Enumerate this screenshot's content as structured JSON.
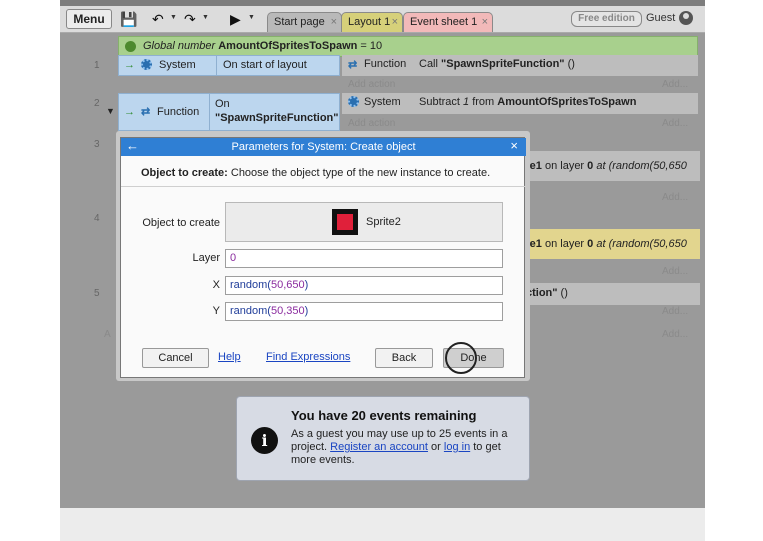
{
  "toolbar": {
    "menu_label": "Menu",
    "tabs": [
      {
        "label": "Start page"
      },
      {
        "label": "Layout 1"
      },
      {
        "label": "Event sheet 1"
      }
    ],
    "edition_badge": "Free edition",
    "user_label": "Guest"
  },
  "sheet": {
    "global_var": {
      "prefix": "Global number",
      "name": "AmountOfSpritesToSpawn",
      "value_text": "= 10"
    },
    "rows": [
      {
        "number": "1",
        "cond_object": "System",
        "cond_text": "On start of layout",
        "act_object": "Function",
        "act_text_prefix": "Call ",
        "act_text_bold": "\"SpawnSpriteFunction\"",
        "act_text_suffix": " ()",
        "add_action": "Add action",
        "add_right": "Add..."
      },
      {
        "number": "2",
        "cond_object": "Function",
        "cond_text_line1": "On",
        "cond_text_line2": "\"SpawnSpriteFunction\"",
        "act_object": "System",
        "act_text_prefix": "Subtract ",
        "act_text_num": "1",
        "act_text_mid": " from ",
        "act_text_bold": "AmountOfSpritesToSpawn",
        "add_action": "Add action",
        "add_right": "Add..."
      },
      {
        "number": "3",
        "partial_bold": "te1",
        "partial_mid": " on layer ",
        "partial_layer": "0",
        "partial_end": " at (random(50,650",
        "add_right": "Add..."
      },
      {
        "number": "4",
        "partial_bold": "te1",
        "partial_mid": " on layer ",
        "partial_layer": "0",
        "partial_end": " at (random(50,650",
        "add_right": "Add..."
      },
      {
        "number": "5",
        "partial_bold": "ction\"",
        "partial_end": " ()",
        "add_right": "Add..."
      }
    ],
    "add_left": "A",
    "add_bottom": "Add..."
  },
  "dialog": {
    "title": "Parameters for System: Create object",
    "desc_bold": "Object to create:",
    "desc_text": " Choose the object type of the new instance to create.",
    "fields": {
      "object_label": "Object to create",
      "object_value": "Sprite2",
      "layer_label": "Layer",
      "layer_value": "0",
      "x_label": "X",
      "x_fn": "random(",
      "x_args": "50,650",
      "x_close": ")",
      "y_label": "Y",
      "y_fn": "random(",
      "y_args": "50,350",
      "y_close": ")"
    },
    "buttons": {
      "cancel": "Cancel",
      "help": "Help",
      "find_expressions": "Find Expressions",
      "back": "Back",
      "done": "Done"
    }
  },
  "notice": {
    "icon": "info-icon",
    "title": "You have 20 events remaining",
    "body_1": "As a guest you may use up to 25 events in a project. ",
    "register_link": "Register an account",
    "body_2": " or ",
    "login_link": "log in",
    "body_3": " to get more events."
  }
}
